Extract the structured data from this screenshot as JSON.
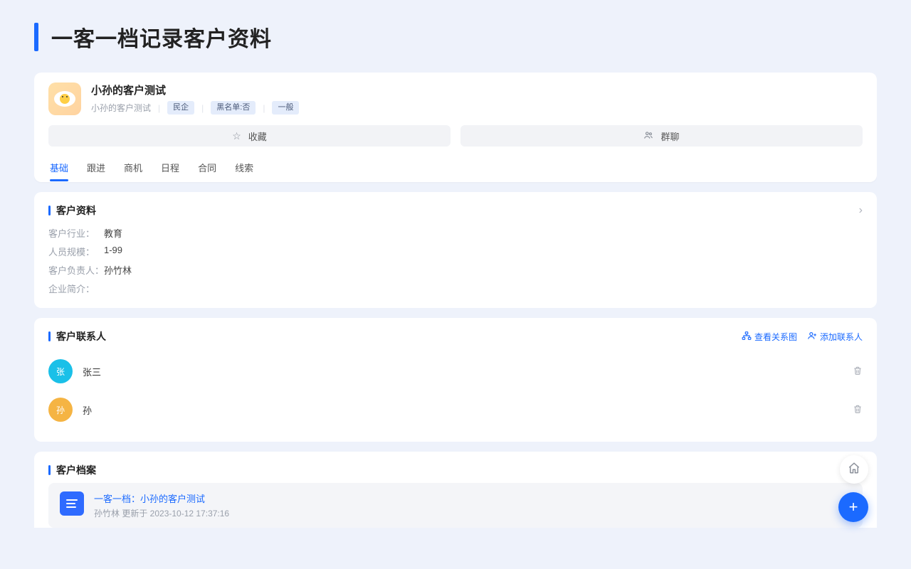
{
  "page": {
    "title": "一客一档记录客户资料"
  },
  "header": {
    "customer_name": "小孙的客户测试",
    "sub_text": "小孙的客户测试",
    "tags": [
      "民企",
      "黑名单:否",
      "一般"
    ],
    "actions": {
      "favorite": "收藏",
      "group_chat": "群聊"
    }
  },
  "tabs": [
    "基础",
    "跟进",
    "商机",
    "日程",
    "合同",
    "线索"
  ],
  "active_tab_index": 0,
  "profile": {
    "section_title": "客户资料",
    "rows": [
      {
        "label": "客户行业：",
        "value": "教育"
      },
      {
        "label": "人员规模：",
        "value": "1-99"
      },
      {
        "label": "客户负责人：",
        "value": "孙竹林"
      },
      {
        "label": "企业简介：",
        "value": ""
      }
    ]
  },
  "contacts": {
    "section_title": "客户联系人",
    "view_graph_label": "查看关系图",
    "add_contact_label": "添加联系人",
    "items": [
      {
        "initial": "张",
        "name": "张三",
        "color": "cyan"
      },
      {
        "initial": "孙",
        "name": "孙",
        "color": "orange"
      }
    ]
  },
  "files": {
    "section_title": "客户档案",
    "file_name": "一客一档：小孙的客户测试",
    "file_meta": "孙竹林 更新于 2023-10-12 17:37:16"
  }
}
